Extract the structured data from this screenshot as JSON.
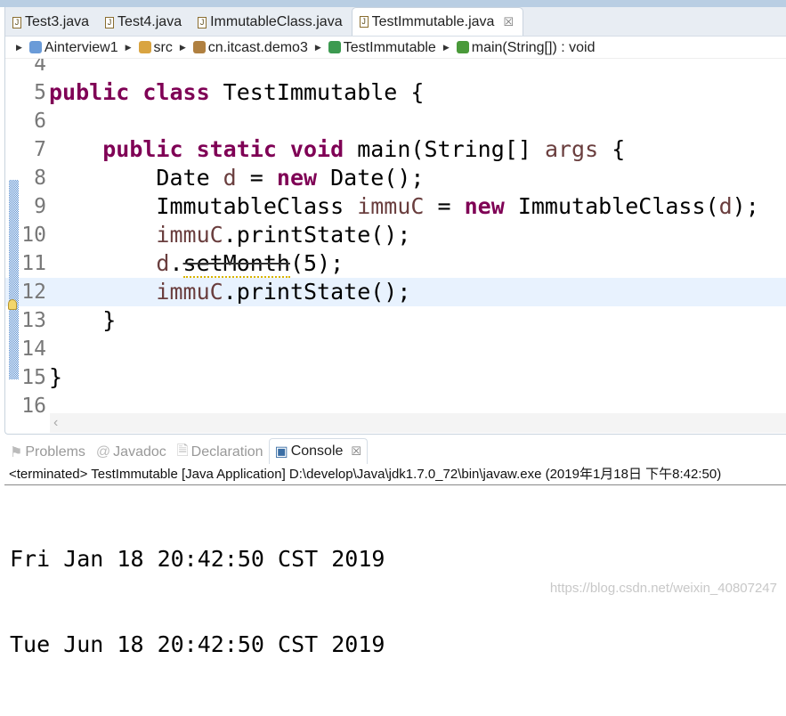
{
  "tabs": [
    {
      "label": "Test3.java"
    },
    {
      "label": "Test4.java"
    },
    {
      "label": "ImmutableClass.java"
    },
    {
      "label": "TestImmutable.java",
      "active": true
    }
  ],
  "breadcrumb": [
    "Ainterview1",
    "src",
    "cn.itcast.demo3",
    "TestImmutable",
    "main(String[]) : void"
  ],
  "code_lines": [
    {
      "n": "4",
      "tokens": []
    },
    {
      "n": "5",
      "tokens": [
        [
          "kw",
          "public"
        ],
        [
          "",
          ""
        ],
        [
          "kw",
          " class"
        ],
        [
          "",
          " TestImmutable {"
        ]
      ]
    },
    {
      "n": "6",
      "tokens": []
    },
    {
      "n": "7",
      "tokens": [
        [
          "",
          "    "
        ],
        [
          "kw",
          "public static void"
        ],
        [
          "",
          " main(String[] "
        ],
        [
          "var",
          "args"
        ],
        [
          "",
          " {"
        ]
      ]
    },
    {
      "n": "8",
      "tokens": [
        [
          "",
          "        Date "
        ],
        [
          "var",
          "d"
        ],
        [
          "",
          " = "
        ],
        [
          "kw",
          "new"
        ],
        [
          "",
          " Date();"
        ]
      ]
    },
    {
      "n": "9",
      "tokens": [
        [
          "",
          "        ImmutableClass "
        ],
        [
          "var",
          "immuC"
        ],
        [
          "",
          " = "
        ],
        [
          "kw",
          "new"
        ],
        [
          "",
          " ImmutableClass("
        ],
        [
          "var",
          "d"
        ],
        [
          "",
          ");"
        ]
      ]
    },
    {
      "n": "10",
      "tokens": [
        [
          "",
          "        "
        ],
        [
          "var",
          "immuC"
        ],
        [
          "",
          ".printState();"
        ]
      ]
    },
    {
      "n": "11",
      "tokens": [
        [
          "",
          "        "
        ],
        [
          "var",
          "d"
        ],
        [
          "",
          "."
        ],
        [
          "dep",
          "setMonth"
        ],
        [
          "",
          "(5);"
        ]
      ]
    },
    {
      "n": "12",
      "tokens": [
        [
          "",
          "        "
        ],
        [
          "var",
          "immuC"
        ],
        [
          "",
          ".printState();"
        ]
      ],
      "highlight": true
    },
    {
      "n": "13",
      "tokens": [
        [
          "",
          "    }"
        ]
      ]
    },
    {
      "n": "14",
      "tokens": []
    },
    {
      "n": "15",
      "tokens": [
        [
          "",
          "}"
        ]
      ]
    },
    {
      "n": "16",
      "tokens": []
    }
  ],
  "panel": {
    "tabs": [
      {
        "label": "Problems"
      },
      {
        "label": "Javadoc"
      },
      {
        "label": "Declaration"
      },
      {
        "label": "Console",
        "active": true
      }
    ],
    "status": "<terminated> TestImmutable [Java Application] D:\\develop\\Java\\jdk1.7.0_72\\bin\\javaw.exe (2019年1月18日 下午8:42:50)",
    "output": [
      "Fri Jan 18 20:42:50 CST 2019",
      "Tue Jun 18 20:42:50 CST 2019"
    ]
  },
  "watermark": "https://blog.csdn.net/weixin_40807247",
  "colors": {
    "keyword": "#7f0055",
    "variable": "#6a3e3e",
    "current_line": "#e8f2fe"
  }
}
